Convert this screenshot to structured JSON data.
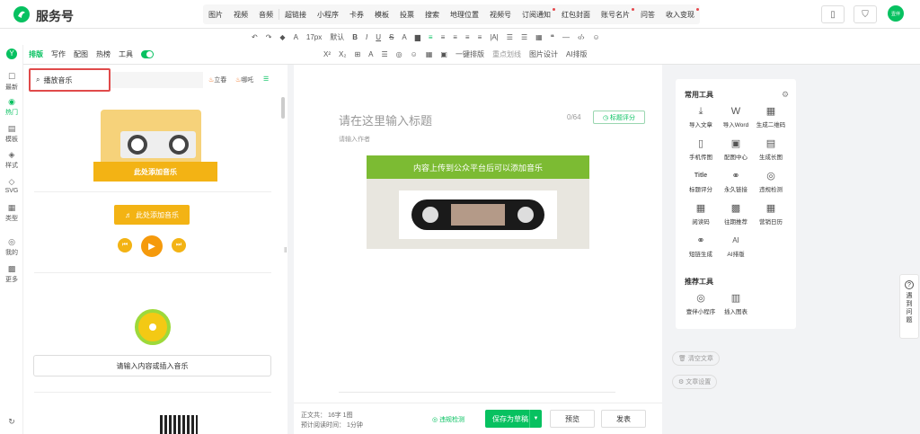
{
  "app": {
    "brand": "服务号",
    "avatar_text": "壹伴"
  },
  "topnav": [
    "图片",
    "视频",
    "音频",
    "超链接",
    "小程序",
    "卡券",
    "模板",
    "投票",
    "搜索",
    "地理位置",
    "视频号",
    "订阅通知",
    "红包封面",
    "账号名片",
    "问答",
    "收入变现"
  ],
  "toolbar": {
    "row1": [
      "↶",
      "↷",
      "◆",
      "A",
      "17px",
      "默认",
      "B",
      "I",
      "U",
      "S",
      "A",
      "▆",
      "≡",
      "≡",
      "≡",
      "≡",
      "≡",
      "|A|",
      "☰",
      "☰",
      "▦",
      "❝",
      "—",
      "‹/›",
      "☺"
    ],
    "row2": [
      "X²",
      "X₂",
      "⊞",
      "A",
      "☰",
      "◎",
      "☺",
      "▦",
      "▣",
      "一键排版",
      "重点划线",
      "图片设计",
      "AI排版"
    ]
  },
  "leftnav": [
    {
      "icon": "☐",
      "label": "最新"
    },
    {
      "icon": "◉",
      "label": "热门"
    },
    {
      "icon": "▤",
      "label": "模板"
    },
    {
      "icon": "◈",
      "label": "样式"
    },
    {
      "icon": "◇",
      "label": "SVG"
    },
    {
      "icon": "▦",
      "label": "类型"
    },
    {
      "icon": "◎",
      "label": "我的"
    },
    {
      "icon": "▩",
      "label": "更多"
    }
  ],
  "lefttabs": [
    "排版",
    "写作",
    "配图",
    "热榜",
    "工具"
  ],
  "search": {
    "value": "播放音乐"
  },
  "chips": [
    "立春",
    "哪吒"
  ],
  "cards": {
    "tape_label": "此处添加音乐",
    "music_label": "此处添加音乐",
    "music_input": "请输入内容或插入音乐"
  },
  "editor": {
    "title_placeholder": "请在这里输入标题",
    "counter": "0/64",
    "title_score": "标题评分",
    "author_placeholder": "请输入作者",
    "banner": "内容上传到公众平台后可以添加音乐",
    "footer_words": "正文共：  16字 1图",
    "footer_time": "预计阅读时间：  1分钟",
    "violation": "违规检测",
    "save_draft": "保存为草稿",
    "preview": "预览",
    "publish": "发表"
  },
  "rightpanel": {
    "common_title": "常用工具",
    "common": [
      {
        "icon": "⤓",
        "label": "导入文章"
      },
      {
        "icon": "W",
        "label": "导入Word"
      },
      {
        "icon": "▦",
        "label": "生成二维码"
      },
      {
        "icon": "▯",
        "label": "手机传图"
      },
      {
        "icon": "▣",
        "label": "配图中心"
      },
      {
        "icon": "▤",
        "label": "生成长图"
      },
      {
        "icon": "Title",
        "label": "标题评分"
      },
      {
        "icon": "⚭",
        "label": "永久链接"
      },
      {
        "icon": "◎",
        "label": "违规检测"
      },
      {
        "icon": "▦",
        "label": "阅读码"
      },
      {
        "icon": "▩",
        "label": "往期推荐"
      },
      {
        "icon": "▦",
        "label": "营销日历"
      },
      {
        "icon": "⚭",
        "label": "短链生成"
      },
      {
        "icon": "AI",
        "label": "AI排版"
      }
    ],
    "recommend_title": "推荐工具",
    "recommend": [
      {
        "icon": "◎",
        "label": "壹伴小程序"
      },
      {
        "icon": "▥",
        "label": "插入图表"
      }
    ]
  },
  "side_actions": [
    "清空文章",
    "文章设置"
  ],
  "help": {
    "icon": "?",
    "label": [
      "遇",
      "到",
      "问",
      "题"
    ]
  }
}
